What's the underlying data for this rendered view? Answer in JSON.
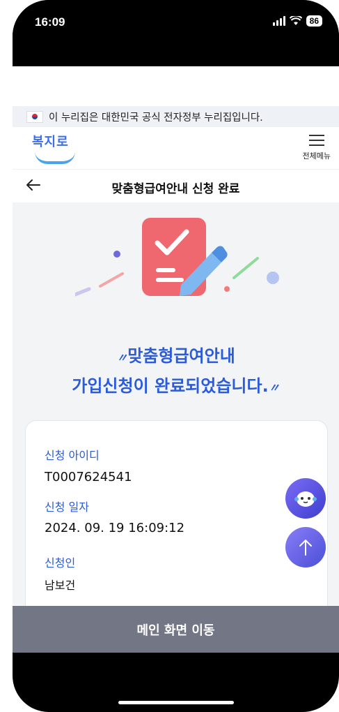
{
  "status_bar": {
    "time": "16:09",
    "battery": "86"
  },
  "gov_banner": {
    "text": "이 누리집은 대한민국 공식 전자정부 누리집입니다."
  },
  "header": {
    "logo_text": "복지로",
    "menu_label": "전체메뉴"
  },
  "page": {
    "title": "맞춤형급여안내 신청 완료"
  },
  "message": {
    "line1": "맞춤형급여안내",
    "line2": "가입신청이 완료되었습니다."
  },
  "details": {
    "items": [
      {
        "label": "신청 아이디",
        "value": "T0007624541"
      },
      {
        "label": "신청 일자",
        "value": "2024. 09. 19 16:09:12"
      },
      {
        "label": "신청인",
        "value": "남보건"
      }
    ]
  },
  "bottom_button": {
    "label": "메인 화면 이동"
  },
  "icons": [
    "back-arrow-icon",
    "hamburger-icon",
    "chatbot-icon",
    "arrow-up-icon",
    "checklist-pencil-icon",
    "korea-flag-icon"
  ]
}
